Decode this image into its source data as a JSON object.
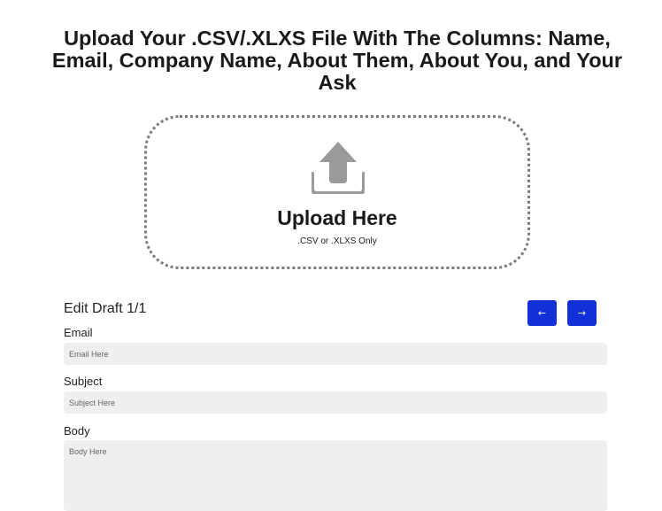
{
  "page": {
    "title": "Upload Your .CSV/.XLXS File With The Columns: Name, Email, Company Name, About Them, About You, and Your Ask"
  },
  "upload": {
    "icon": "upload-tray-arrow-icon",
    "title": "Upload Here",
    "subtitle": ".CSV or .XLXS Only"
  },
  "draft": {
    "heading": "Edit Draft 1/1",
    "prev_label": "←",
    "next_label": "→",
    "email": {
      "label": "Email",
      "placeholder": "Email Here",
      "value": ""
    },
    "subject": {
      "label": "Subject",
      "placeholder": "Subject Here",
      "value": ""
    },
    "body": {
      "label": "Body",
      "placeholder": "Body Here",
      "value": ""
    }
  },
  "colors": {
    "accent": "#1130d8",
    "input_bg": "#efefef",
    "dropzone_border": "#7a7a7a",
    "icon_gray": "#9a9a9a"
  }
}
